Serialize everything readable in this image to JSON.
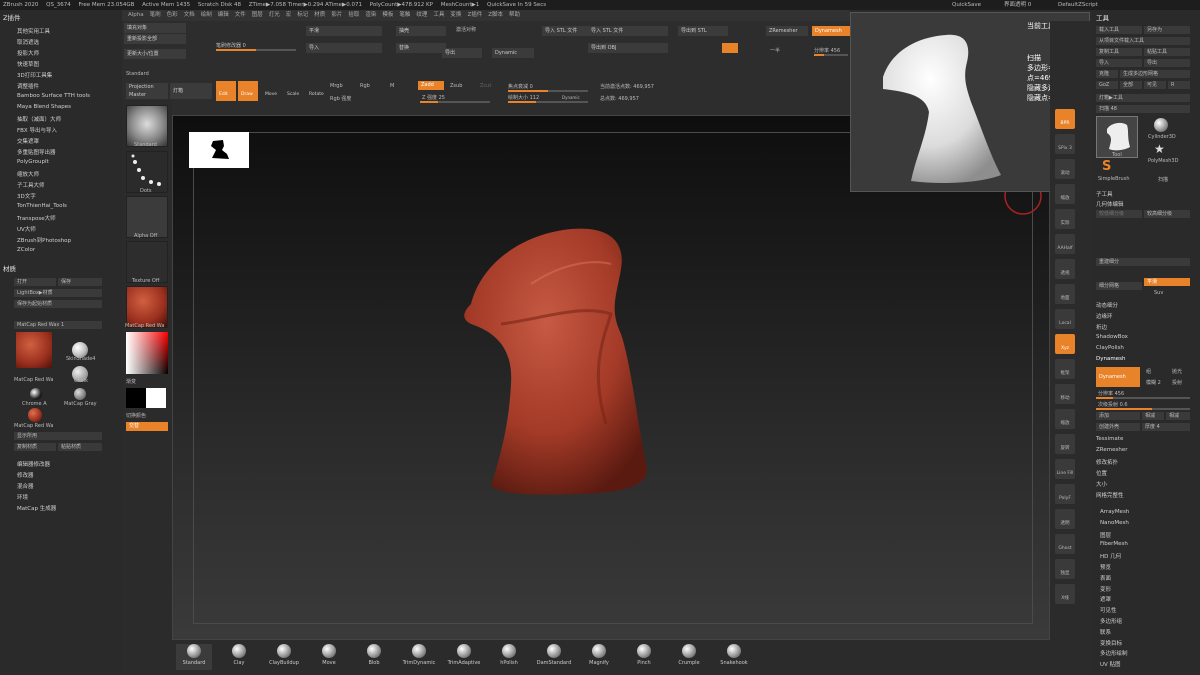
{
  "titlebar": {
    "app": "ZBrush 2020",
    "doc": "QS_3674",
    "free_mem": "Free Mem 23.054GB",
    "active_mem": "Active Mem 1435",
    "scratch": "Scratch Disk 48",
    "ztime": "ZTime▶7.058 Timer▶0.294 ATime▶0.071",
    "polycount": "PolyCount▶478.912 KP",
    "meshcount": "MeshCount▶1",
    "quicksave": "QuickSave In 59 Secs",
    "quicksave_btn": "QuickSave",
    "ui_transparency": "界面透明 0",
    "script": "DefaultZScript"
  },
  "menubar": [
    "Alpha",
    "笔刷",
    "色彩",
    "文档",
    "绘制",
    "编辑",
    "文件",
    "图层",
    "灯光",
    "宏",
    "标记",
    "材质",
    "影片",
    "拾取",
    "渲染",
    "模板",
    "笔触",
    "纹理",
    "工具",
    "变换",
    "Z插件",
    "Z脚本",
    "帮助"
  ],
  "leftpanel": {
    "zplugin_title": "Z插件",
    "plugins": [
      "其他实用工具",
      "取消遮选",
      "投影大师",
      "快速草图",
      "3D打印工具集",
      "调整插件",
      "Bamboo Surface TTH tools",
      "Maya Blend Shapes",
      "抽取（减面）大师",
      "FBX 导出与导入",
      "交集遮罩",
      "多重贴图导出器",
      "PolyGroupIt",
      "缩放大师",
      "子工具大师",
      "3D文字",
      "TonThienHai_Tools",
      "Transpose大师",
      "UV大师",
      "ZBrush到Photoshop",
      "ZColor"
    ],
    "material_title": "材质",
    "mat_buttons": [
      "打开",
      "保存",
      "LightBox▶材质",
      "保存为起始材质"
    ],
    "current_material": "MatCap Red Wax  1",
    "materials": [
      "MatCap Red Wa",
      "SkinShade4",
      "Chalk",
      "Chrome A",
      "MatCap Gray",
      "MatCap Red Wa"
    ],
    "mat_actions": [
      "显示所用",
      "复制材质",
      "粘贴材质"
    ],
    "sections": [
      "编辑器修改器",
      "修改器",
      "混合器",
      "环境",
      "MatCap 生成器"
    ]
  },
  "topshelf": {
    "fill_btn": "填充对象",
    "project_all": "重新投影全部",
    "update_size": "更新大小/位置",
    "bpr_label": "笔刷修改器 0",
    "projection_master": "Projection Master",
    "lightbox": "灯箱",
    "edit": "Edit",
    "draw": "Draw",
    "move": "Move",
    "scale": "Scale",
    "rotate": "Rotate",
    "mrgb": "Mrgb",
    "rgb": "Rgb",
    "m": "M",
    "zadd": "Zadd",
    "zsub": "Zsub",
    "zcut": "Zcut",
    "focal": "焦点衰减 0",
    "draw_size": "绘制大小 112",
    "rgb_intensity": "Rgb 强度",
    "z_intensity": "Z 强度 25",
    "active_points": "当前激活点数: 469,957",
    "total_points": "总点数: 469,957",
    "dynamic": "Dynamic",
    "smooth_lbl": "平滑",
    "import": "导入",
    "export": "导出",
    "import_stl": "导入 STL 文件",
    "export_stl": "导出到 STL",
    "export_obj": "导出到 OBJ",
    "zremesher": "ZRemesher",
    "dynamesh": "Dynamesh",
    "resolution": "分辨率 456",
    "half": "一半",
    "symmetry": "激活对称",
    "hollow": "抽壳",
    "morph": "替换"
  },
  "leftshelf": {
    "standard": "Standard",
    "dots": "Dots",
    "alpha_off": "Alpha Off",
    "texture_off": "Texture Off",
    "material": "MatCap Red Wa",
    "gradient": "渐变",
    "switch_color": "切换颜色",
    "alternate": "交替"
  },
  "bottombar": {
    "brushes": [
      "Standard",
      "Clay",
      "ClayBuildup",
      "Move",
      "Blob",
      "TrimDynamic",
      "TrimAdaptive",
      "hPolish",
      "DamStandard",
      "Magnify",
      "Pinch",
      "Crumple",
      "Snakehook"
    ]
  },
  "popup": {
    "title": "当前工具",
    "stats": [
      "扫描",
      "多边形=478912",
      "点=469957",
      "隐藏多边形=0",
      "隐藏点=0"
    ]
  },
  "rightshelf": [
    "BPR",
    "SPix 3",
    "滚动",
    "缩放",
    "实际",
    "AAHalf",
    "透视",
    "地面",
    "Local",
    "Xyz",
    "框架",
    "移动",
    "缩放",
    "旋转",
    "Line Fill",
    "PolyF",
    "透明",
    "Ghost",
    "独显",
    "X线"
  ],
  "rightpanel": {
    "title": "工具",
    "buttons": [
      "载入工具",
      "另存为",
      "从项目文件载入工具",
      "复制工具",
      "粘贴工具",
      "导入",
      "导出",
      "克隆",
      "生成多边形网格",
      "GoZ",
      "全部",
      "可见",
      "R"
    ],
    "lightbox_tools": "灯箱▶工具",
    "current": "扫描  48",
    "tools": [
      "Tool",
      "Cylinder3D",
      "SimpleBrush",
      "PolyMesh3D",
      "扫描"
    ],
    "subtool": "子工具",
    "geometry": "几何体编辑",
    "lower": "较低细分级",
    "higher": "较高细分级",
    "divide": "细分网格",
    "smt": "平滑",
    "suv": "Suv",
    "reconstruct": "重建细分",
    "dynamic_sub": "动态细分",
    "edge_loop": "边缘环",
    "crease": "折边",
    "shadowbox": "ShadowBox",
    "claypolish": "ClayPolish",
    "dynamesh_hdr": "Dynamesh",
    "dynamesh_btn": "Dynamesh",
    "group": "组",
    "polish": "抛光",
    "blur": "模糊 2",
    "project": "投射",
    "resolution": "分辨率 456",
    "sub_projection": "次级投射 0.6",
    "add": "添加",
    "sub": "相减",
    "create_shell": "创建外壳",
    "thickness": "厚度 4",
    "tessimate": "Tessimate",
    "zremesher": "ZRemesher",
    "modify_topo": "修改拓扑",
    "position": "位置",
    "size": "大小",
    "mesh_integrity": "网格完整性",
    "sections": [
      "ArrayMesh",
      "NanoMesh",
      "图层",
      "FiberMesh",
      "HD 几何",
      "预览",
      "表面",
      "变形",
      "遮罩",
      "可见性",
      "多边形组",
      "联系",
      "变换目标",
      "多边形绘制",
      "UV 贴图"
    ]
  },
  "colors": {
    "accent": "#e8832a",
    "clay": "#b5432f"
  }
}
